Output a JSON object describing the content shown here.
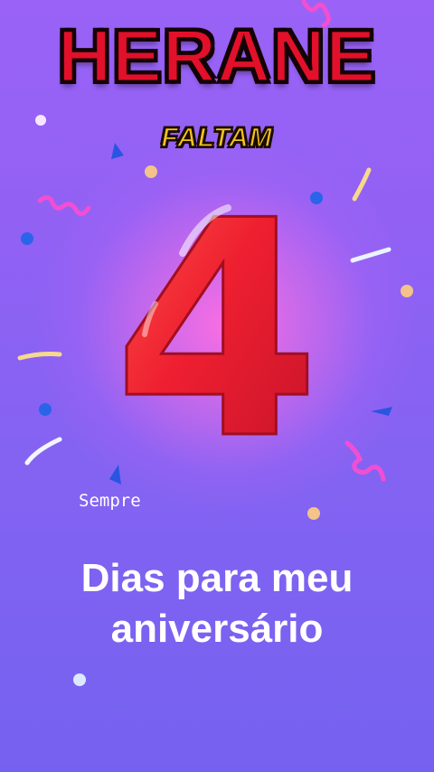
{
  "name": "HERANE",
  "subtitle": "FALTAM",
  "countdown_number": "4",
  "small_label": "Sempre",
  "caption_line1": "Dias para meu",
  "caption_line2": "aniversário",
  "colors": {
    "background": "#9161f4",
    "title": "#e2102a",
    "subtitle": "#f4c21c",
    "balloon": "#ee2035"
  }
}
